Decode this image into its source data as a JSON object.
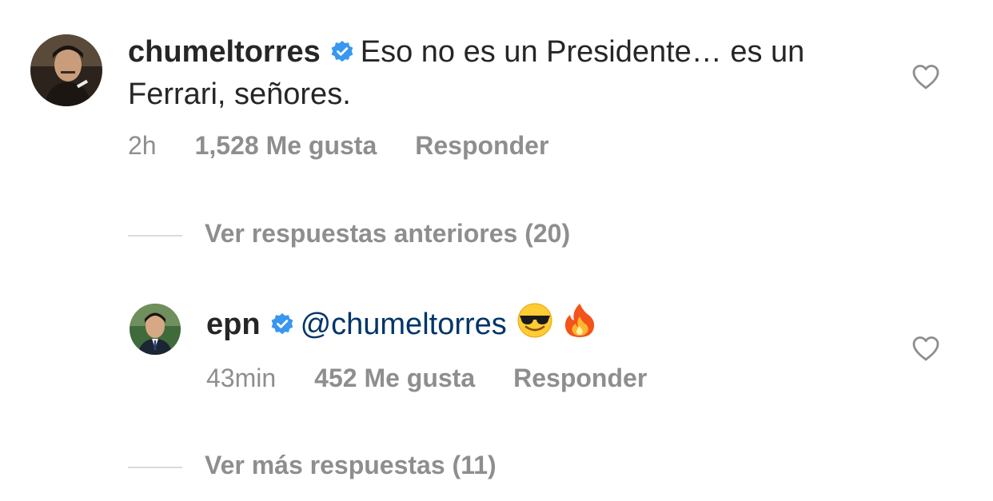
{
  "comments": [
    {
      "username": "chumeltorres",
      "text": "Eso no es un Presidente… es un Ferrari, señores.",
      "time": "2h",
      "likes": "1,528 Me gusta",
      "reply": "Responder",
      "avatar_icon": "user-avatar-chumeltorres"
    },
    {
      "username": "epn",
      "mention": "@chumeltorres",
      "emojis": [
        "smiling-face-with-sunglasses",
        "fire"
      ],
      "time": "43min",
      "likes": "452 Me gusta",
      "reply": "Responder",
      "avatar_icon": "user-avatar-epn"
    }
  ],
  "replies": {
    "previous": "Ver respuestas anteriores (20)",
    "more": "Ver más respuestas (11)"
  },
  "colors": {
    "text": "#262626",
    "muted": "#8e8e8e",
    "mention": "#003569",
    "verified": "#3897f0",
    "divider": "#dbdbdb"
  },
  "icons": {
    "verified": "verified-badge-icon",
    "like": "heart-outline-icon"
  }
}
